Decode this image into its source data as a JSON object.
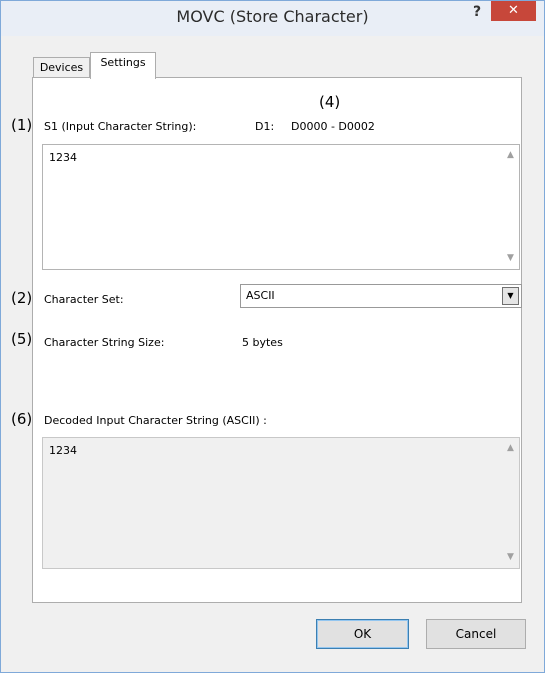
{
  "window": {
    "title": "MOVC  (Store Character)",
    "help_label": "?",
    "close_label": "✕"
  },
  "tabs": [
    {
      "label": "Devices",
      "active": false
    },
    {
      "label": "Settings",
      "active": true
    }
  ],
  "settings": {
    "s1": {
      "marker": "(1)",
      "label": "S1 (Input Character String):",
      "value": "1234"
    },
    "d1": {
      "marker": "(4)",
      "label": "D1:",
      "value": "D0000 - D0002"
    },
    "charset": {
      "marker": "(2)",
      "label": "Character Set:",
      "selected": "ASCII"
    },
    "size": {
      "marker": "(5)",
      "label": "Character String Size:",
      "value": "5 bytes"
    },
    "decoded": {
      "marker": "(6)",
      "label": "Decoded Input Character String (ASCII) :",
      "value": "1234"
    }
  },
  "buttons": {
    "ok_label": "OK",
    "cancel_label": "Cancel"
  },
  "icons": {
    "scroll_up": "▲",
    "scroll_down": "▼",
    "combo_arrow": "▼"
  }
}
